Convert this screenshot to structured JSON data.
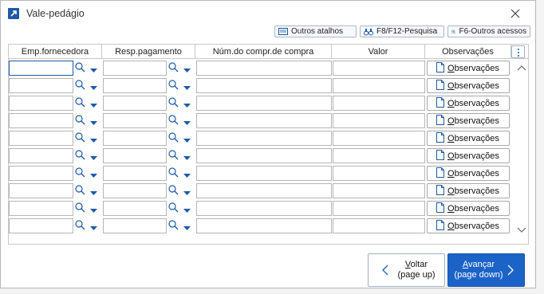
{
  "window": {
    "title": "Vale-pedágio"
  },
  "toolbar": {
    "outros_atalhos": "Outros atalhos",
    "pesquisa": "F8/F12-Pesquisa",
    "outros_acessos": "F6-Outros acessos"
  },
  "grid": {
    "columns": [
      "Emp.fornecedora",
      "Resp.pagamento",
      "Núm.do compr.de compra",
      "Valor",
      "Observações"
    ],
    "rows": [
      {
        "observacoes_label": "Observações"
      },
      {
        "observacoes_label": "Observações"
      },
      {
        "observacoes_label": "Observações"
      },
      {
        "observacoes_label": "Observações"
      },
      {
        "observacoes_label": "Observações"
      },
      {
        "observacoes_label": "Observações"
      },
      {
        "observacoes_label": "Observações"
      },
      {
        "observacoes_label": "Observações"
      },
      {
        "observacoes_label": "Observações"
      },
      {
        "observacoes_label": "Observações"
      }
    ]
  },
  "footer": {
    "back_label": "Voltar",
    "back_hint": "(page up)",
    "next_label": "Avançar",
    "next_hint": "(page down)"
  },
  "colors": {
    "accent": "#1c63c7",
    "border": "#c8c8c8"
  }
}
